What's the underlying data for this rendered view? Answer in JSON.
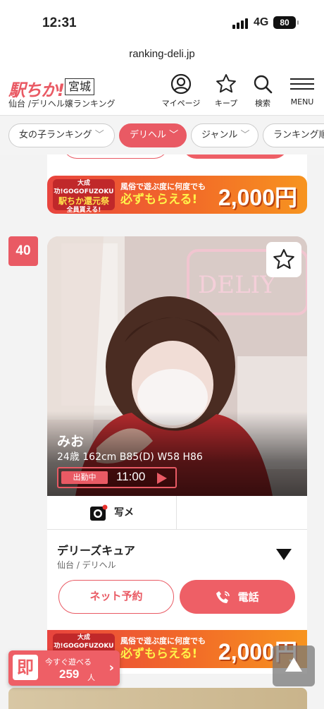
{
  "status": {
    "time": "12:31",
    "network": "4G",
    "battery": "80"
  },
  "url": "ranking-deli.jp",
  "header": {
    "logo": "駅ちか!",
    "prefecture": "宮城",
    "subtitle": "仙台 /デリヘル嬢ランキング",
    "nav": [
      {
        "label": "マイページ",
        "icon": "user-circle-icon"
      },
      {
        "label": "キープ",
        "icon": "star-icon"
      },
      {
        "label": "検索",
        "icon": "search-icon"
      },
      {
        "label": "MENU",
        "icon": "hamburger-icon"
      }
    ]
  },
  "filters": [
    {
      "label": "女の子ランキング",
      "active": false
    },
    {
      "label": "デリヘル",
      "active": true
    },
    {
      "label": "ジャンル",
      "active": false
    },
    {
      "label": "ランキング順",
      "active": false
    }
  ],
  "banner": {
    "badge_small": "大成功!GOGOFUZOKU",
    "badge_main": "駅ちか還元祭",
    "badge_sub": "全員貰える!",
    "line1": "風俗で遊ぶ度に何度でも",
    "line2": "必ずもらえる!",
    "amount": "2,000円"
  },
  "card": {
    "rank": "40",
    "name": "みお",
    "specs": "24歳 162cm B85(D) W58 H86",
    "duty_tag": "出勤中",
    "duty_time": "11:00",
    "photo_label": "写メ",
    "shop": "デリーズキュア",
    "area": "仙台 / デリヘル",
    "reserve_label": "ネット予約",
    "call_label": "電話"
  },
  "floating": {
    "kanji": "即",
    "line1": "今すぐ遊べる",
    "count": "259",
    "unit": "人"
  },
  "colors": {
    "accent": "#e95a64",
    "banner_orange": "#f26b28"
  }
}
